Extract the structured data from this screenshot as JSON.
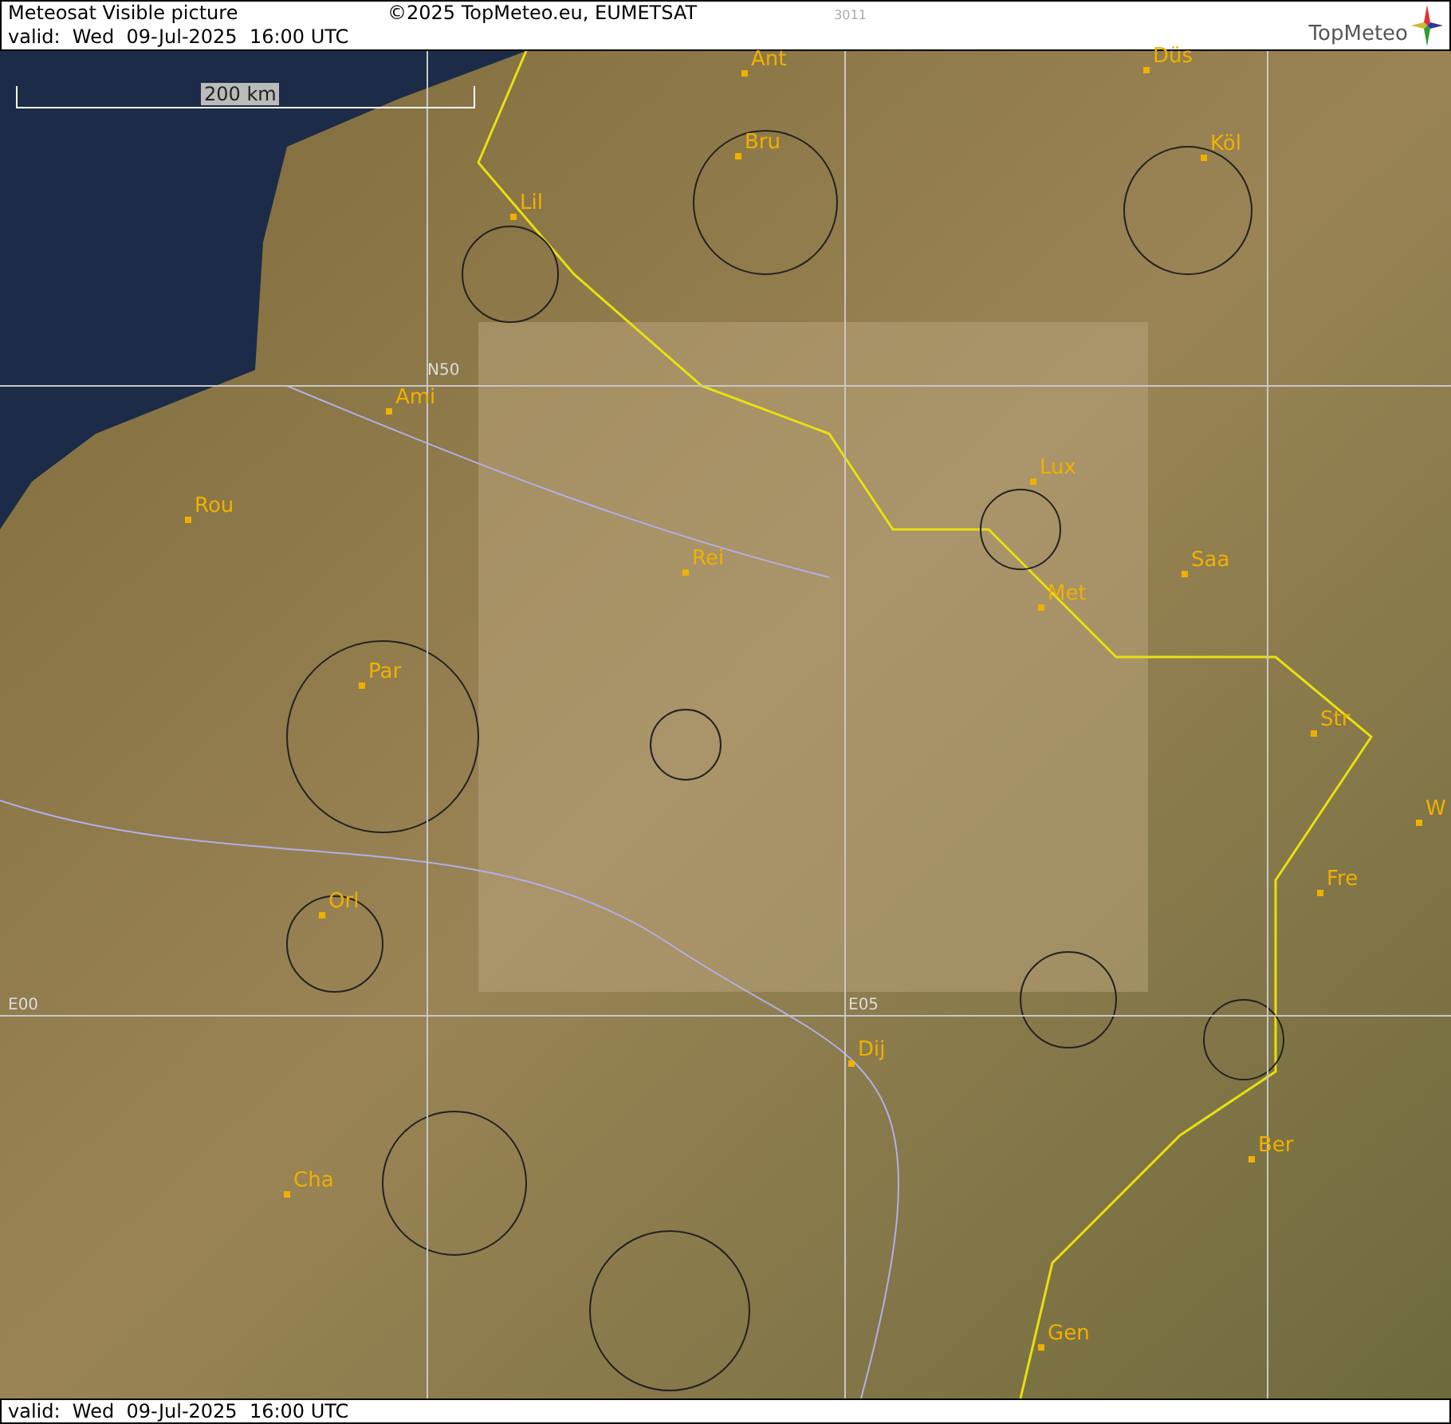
{
  "header": {
    "title": "Meteosat Visible picture",
    "valid": "valid:  Wed  09-Jul-2025  16:00 UTC",
    "copyright": "©2025 TopMeteo.eu, EUMETSAT",
    "code": "3011",
    "logo": "TopMeteo"
  },
  "map": {
    "scale": "200 km",
    "grid_labels": [
      "N50",
      "E00",
      "E05"
    ],
    "cities": [
      "Ant",
      "Düs",
      "Bru",
      "Köl",
      "Lil",
      "Ami",
      "Rou",
      "Rei",
      "Lux",
      "Saa",
      "Met",
      "Par",
      "Str",
      "W",
      "Fre",
      "Orl",
      "Dij",
      "Ber",
      "Cha",
      "Gen"
    ]
  },
  "footer": {
    "valid": "valid:  Wed  09-Jul-2025  16:00 UTC"
  }
}
